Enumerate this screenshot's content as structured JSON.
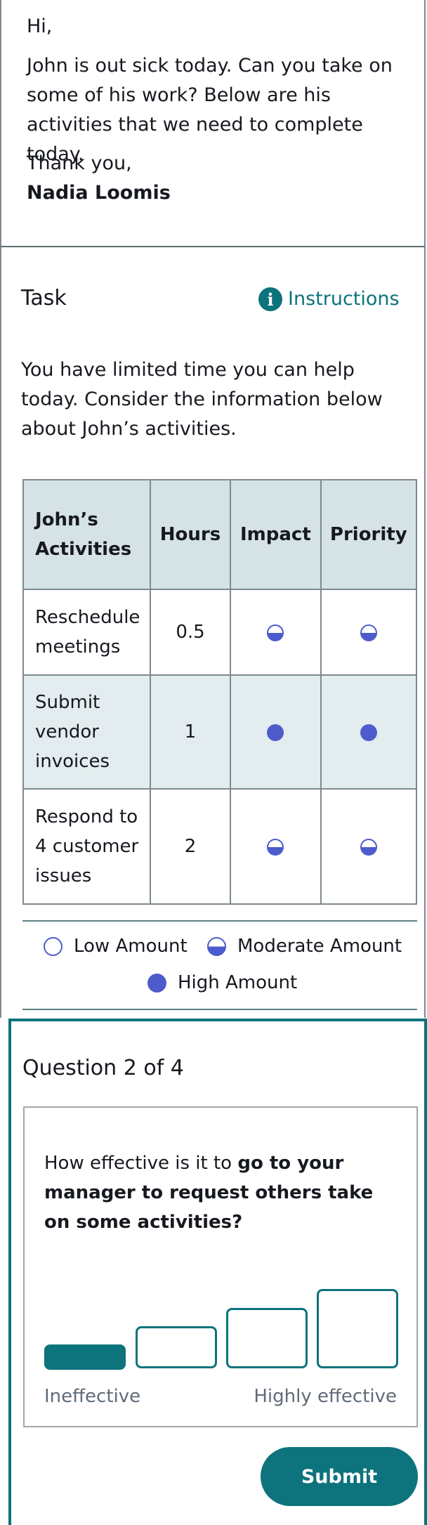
{
  "email": {
    "greeting": "Hi,",
    "body": "John is out sick today. Can you take on some of his work? Below are his activities that we need to complete today.",
    "closing": "Thank you,",
    "signature": "Nadia Loomis"
  },
  "task": {
    "title": "Task",
    "instructions_label": "Instructions",
    "instructions_icon": "info-icon",
    "description": "You have limited time you can help today. Consider the information below about John’s activities."
  },
  "table": {
    "headers": {
      "activity": "John’s Activities",
      "hours": "Hours",
      "impact": "Impact",
      "priority": "Priority"
    },
    "rows": [
      {
        "activity": "Reschedule meetings",
        "hours": "0.5",
        "impact": "moderate",
        "priority": "moderate"
      },
      {
        "activity": "Submit vendor invoices",
        "hours": "1",
        "impact": "high",
        "priority": "high"
      },
      {
        "activity": "Respond to 4 customer issues",
        "hours": "2",
        "impact": "moderate",
        "priority": "moderate"
      }
    ]
  },
  "legend": {
    "low": "Low Amount",
    "moderate": "Moderate Amount",
    "high": "High Amount"
  },
  "question": {
    "title": "Question 2 of 4",
    "text_plain": "How effective is it to ",
    "text_bold": "go to your manager to request others take on some activities?",
    "scale_low_label": "Ineffective",
    "scale_high_label": "Highly effective",
    "options_count": 4,
    "selected_option": 1,
    "submit_label": "Submit"
  },
  "colors": {
    "accent": "#0d737c",
    "indicator": "#4d5bcc",
    "header_bg": "#d5e2e6"
  }
}
